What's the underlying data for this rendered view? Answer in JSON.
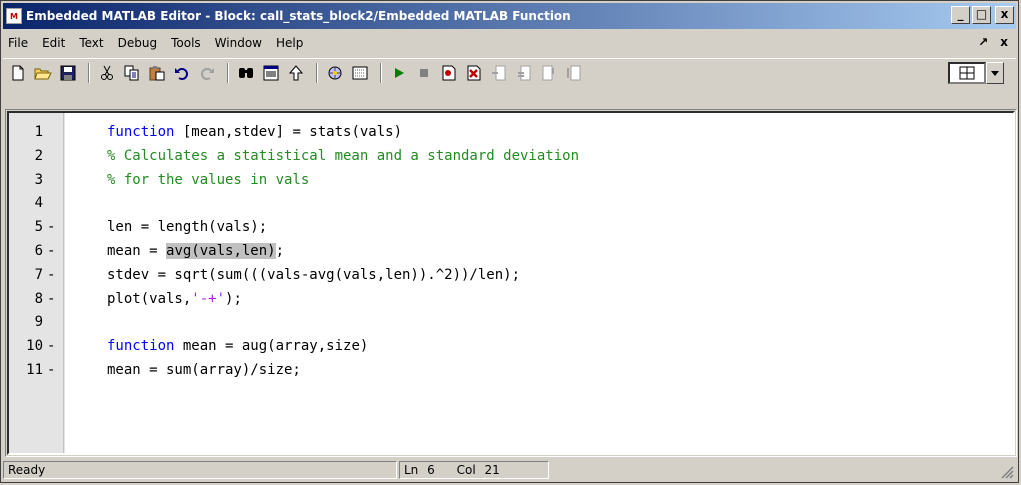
{
  "window": {
    "title": "Embedded MATLAB Editor - Block: call_stats_block2/Embedded MATLAB Function",
    "app_icon_text": "M",
    "minimize": "_",
    "maximize": "□",
    "close": "x"
  },
  "menubar": {
    "items": [
      "File",
      "Edit",
      "Text",
      "Debug",
      "Tools",
      "Window",
      "Help"
    ],
    "dock": "↗",
    "close": "x"
  },
  "toolbar": {
    "icons": [
      "new-file-icon",
      "open-folder-icon",
      "save-icon",
      "cut-icon",
      "copy-icon",
      "paste-icon",
      "undo-icon",
      "redo-icon",
      "find-icon",
      "goto-icon",
      "up-icon",
      "build-icon",
      "model-icon",
      "run-icon",
      "stop-icon",
      "set-breakpoint-icon",
      "clear-breakpoints-icon",
      "step-in-icon",
      "step-out-icon",
      "step-icon",
      "exit-debug-icon",
      "layout-icon"
    ]
  },
  "editor": {
    "lines": [
      {
        "num": "1",
        "dash": "",
        "parts": [
          {
            "t": "function",
            "c": "kw"
          },
          {
            "t": " [mean,stdev] = stats(vals)",
            "c": ""
          }
        ]
      },
      {
        "num": "2",
        "dash": "",
        "parts": [
          {
            "t": "% Calculates a statistical mean and a standard deviation",
            "c": "cm"
          }
        ]
      },
      {
        "num": "3",
        "dash": "",
        "parts": [
          {
            "t": "% for the values in vals",
            "c": "cm"
          }
        ]
      },
      {
        "num": "4",
        "dash": "",
        "parts": []
      },
      {
        "num": "5",
        "dash": "-",
        "parts": [
          {
            "t": "len = length(vals);",
            "c": ""
          }
        ]
      },
      {
        "num": "6",
        "dash": "-",
        "parts": [
          {
            "t": "mean = ",
            "c": ""
          },
          {
            "t": "avg(vals,len)",
            "c": "hl"
          },
          {
            "t": ";",
            "c": ""
          }
        ]
      },
      {
        "num": "7",
        "dash": "-",
        "parts": [
          {
            "t": "stdev = sqrt(sum(((vals-avg(vals,len)).^2))/len);",
            "c": ""
          }
        ]
      },
      {
        "num": "8",
        "dash": "-",
        "parts": [
          {
            "t": "plot(vals,",
            "c": ""
          },
          {
            "t": "'-+'",
            "c": "st"
          },
          {
            "t": ");",
            "c": ""
          }
        ]
      },
      {
        "num": "9",
        "dash": "",
        "parts": []
      },
      {
        "num": "10",
        "dash": "-",
        "parts": [
          {
            "t": "function",
            "c": "kw"
          },
          {
            "t": " mean = aug(array,size)",
            "c": ""
          }
        ]
      },
      {
        "num": "11",
        "dash": "-",
        "parts": [
          {
            "t": "mean = sum(array)/size;",
            "c": ""
          }
        ]
      }
    ]
  },
  "status": {
    "state": "Ready",
    "ln_label": "Ln",
    "ln_value": "6",
    "col_label": "Col",
    "col_value": "21"
  }
}
